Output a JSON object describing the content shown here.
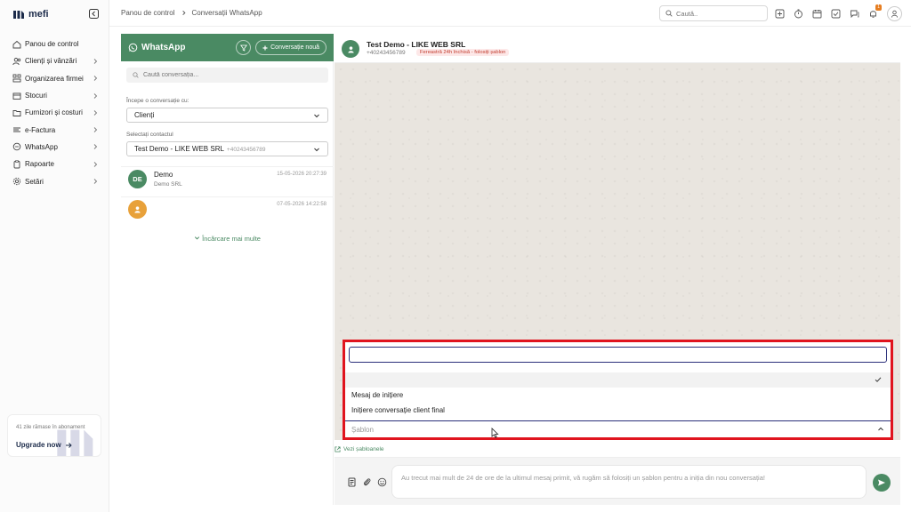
{
  "app": {
    "brand": "mefi"
  },
  "sidebar": {
    "items": [
      {
        "label": "Panou de control",
        "icon": "home-icon",
        "chevron": false
      },
      {
        "label": "Clienți și vânzări",
        "icon": "users-icon",
        "chevron": true
      },
      {
        "label": "Organizarea firmei",
        "icon": "org-icon",
        "chevron": true
      },
      {
        "label": "Stocuri",
        "icon": "box-icon",
        "chevron": true
      },
      {
        "label": "Furnizori și costuri",
        "icon": "folder-icon",
        "chevron": true
      },
      {
        "label": "e-Factura",
        "icon": "invoice-icon",
        "chevron": true
      },
      {
        "label": "WhatsApp",
        "icon": "chat-icon",
        "chevron": true
      },
      {
        "label": "Rapoarte",
        "icon": "clipboard-icon",
        "chevron": true
      },
      {
        "label": "Setări",
        "icon": "gear-icon",
        "chevron": true
      }
    ],
    "subscription": {
      "text": "41 zile rămase în abonament",
      "link": "Upgrade now"
    }
  },
  "topbar": {
    "breadcrumb": [
      "Panou de control",
      "Conversații WhatsApp"
    ],
    "search_placeholder": "Caută..",
    "notification_count": "1"
  },
  "conversations": {
    "title": "WhatsApp",
    "new_button": "Conversație nouă",
    "search_placeholder": "Caută conversația...",
    "start_label": "Începe o conversație cu:",
    "start_value": "Clienți",
    "contact_label": "Selectați contactul",
    "contact_value": "Test Demo - LIKE WEB SRL",
    "contact_phone": "+40243456789",
    "items": [
      {
        "initials": "DE",
        "name": "Demo",
        "subtitle": "Demo SRL",
        "time": "15-05-2026 20:27:39",
        "color": "#4a8a63"
      },
      {
        "initials": "",
        "name": "",
        "subtitle": "",
        "time": "07-05-2026 14:22:58",
        "color": "#e8a13a"
      }
    ],
    "load_more": "Încărcare mai multe"
  },
  "chat": {
    "contact_name": "Test Demo - LIKE WEB SRL",
    "contact_phone": "+40243456789",
    "window_badge": "Fereastră 24h închisă - folosiți șablon",
    "templates_link": "Vezi șabloanele",
    "message_placeholder": "Au trecut mai mult de 24 de ore de la ultimul mesaj primit, vă rugăm să folosiți un șablon pentru a iniția din nou conversația!"
  },
  "template_dropdown": {
    "search_value": "",
    "options": [
      "",
      "Mesaj de inițiere",
      "Inițiere conversație client final"
    ],
    "select_placeholder": "Șablon"
  },
  "colors": {
    "accent": "#4a8a63",
    "highlight": "#e0141e",
    "focus": "#2a2f7a",
    "brand": "#1c2b4a"
  }
}
